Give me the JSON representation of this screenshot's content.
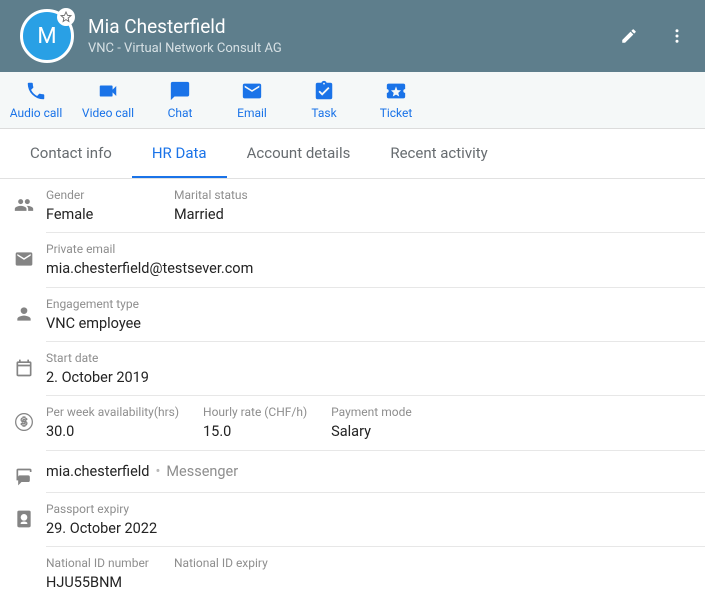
{
  "header": {
    "avatar_initial": "M",
    "name": "Mia Chesterfield",
    "subtitle": "VNC - Virtual Network Consult AG"
  },
  "actions": {
    "audio_call": "Audio call",
    "video_call": "Video call",
    "chat": "Chat",
    "email": "Email",
    "task": "Task",
    "ticket": "Ticket"
  },
  "tabs": {
    "contact_info": "Contact info",
    "hr_data": "HR Data",
    "account_details": "Account details",
    "recent_activity": "Recent activity",
    "active": "hr_data"
  },
  "hr": {
    "gender": {
      "label": "Gender",
      "value": "Female"
    },
    "marital_status": {
      "label": "Marital status",
      "value": "Married"
    },
    "private_email": {
      "label": "Private email",
      "value": "mia.chesterfield@testsever.com"
    },
    "engagement_type": {
      "label": "Engagement type",
      "value": "VNC employee"
    },
    "start_date": {
      "label": "Start date",
      "value": "2. October 2019"
    },
    "availability": {
      "label": "Per week availability(hrs)",
      "value": "30.0"
    },
    "hourly_rate": {
      "label": "Hourly rate (CHF/h)",
      "value": "15.0"
    },
    "payment_mode": {
      "label": "Payment mode",
      "value": "Salary"
    },
    "messenger": {
      "handle": "mia.chesterfield",
      "type": "Messenger"
    },
    "passport_expiry": {
      "label": "Passport expiry",
      "value": "29. October 2022"
    },
    "national_id_number": {
      "label": "National ID number",
      "value": "HJU55BNM"
    },
    "national_id_expiry": {
      "label": "National ID expiry",
      "value": ""
    }
  }
}
